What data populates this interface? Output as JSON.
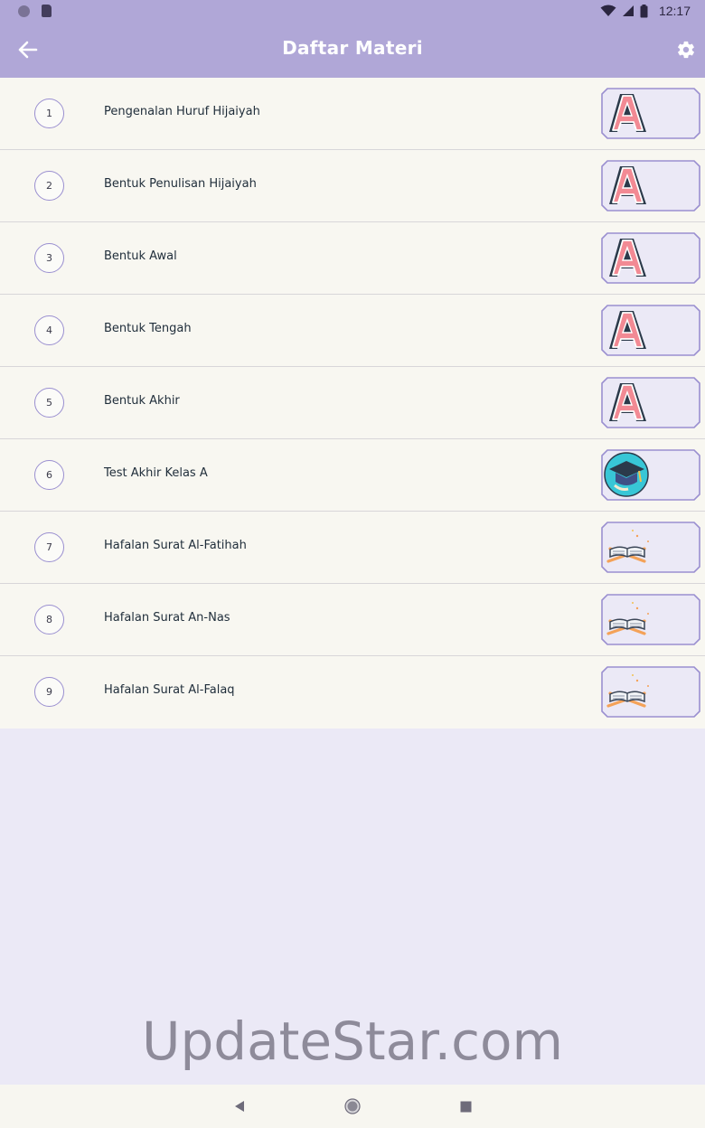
{
  "status_bar": {
    "time": "12:17",
    "icons": [
      "notification-dot-icon",
      "sd-card-icon",
      "wifi-icon",
      "cell-signal-icon",
      "battery-icon"
    ]
  },
  "app_bar": {
    "title": "Daftar Materi",
    "back_icon": "arrow-back-icon",
    "settings_icon": "gear-icon",
    "background": "#b0a7d7"
  },
  "materials": [
    {
      "number": "1",
      "label": "Pengenalan Huruf Hijaiyah",
      "thumbnail": "letter-a-icon"
    },
    {
      "number": "2",
      "label": "Bentuk Penulisan Hijaiyah",
      "thumbnail": "letter-a-icon"
    },
    {
      "number": "3",
      "label": "Bentuk Awal",
      "thumbnail": "letter-a-icon"
    },
    {
      "number": "4",
      "label": "Bentuk Tengah",
      "thumbnail": "letter-a-icon"
    },
    {
      "number": "5",
      "label": "Bentuk Akhir",
      "thumbnail": "letter-a-icon"
    },
    {
      "number": "6",
      "label": "Test Akhir Kelas A",
      "thumbnail": "graduation-cap-icon"
    },
    {
      "number": "7",
      "label": "Hafalan Surat Al-Fatihah",
      "thumbnail": "quran-stand-icon"
    },
    {
      "number": "8",
      "label": "Hafalan Surat An-Nas",
      "thumbnail": "quran-stand-icon"
    },
    {
      "number": "9",
      "label": "Hafalan Surat Al-Falaq",
      "thumbnail": "quran-stand-icon"
    }
  ],
  "watermark": "UpdateStar.com",
  "colors": {
    "accent": "#b0a7d7",
    "row_background": "#f8f7f1",
    "page_background": "#ebe9f6",
    "thumbnail_background": "#ebe9f6",
    "thumbnail_border": "#9a8fd0",
    "letter_fill": "#f28a94"
  },
  "nav_bar": {
    "icons": [
      "nav-back-icon",
      "nav-home-icon",
      "nav-recent-icon"
    ]
  }
}
